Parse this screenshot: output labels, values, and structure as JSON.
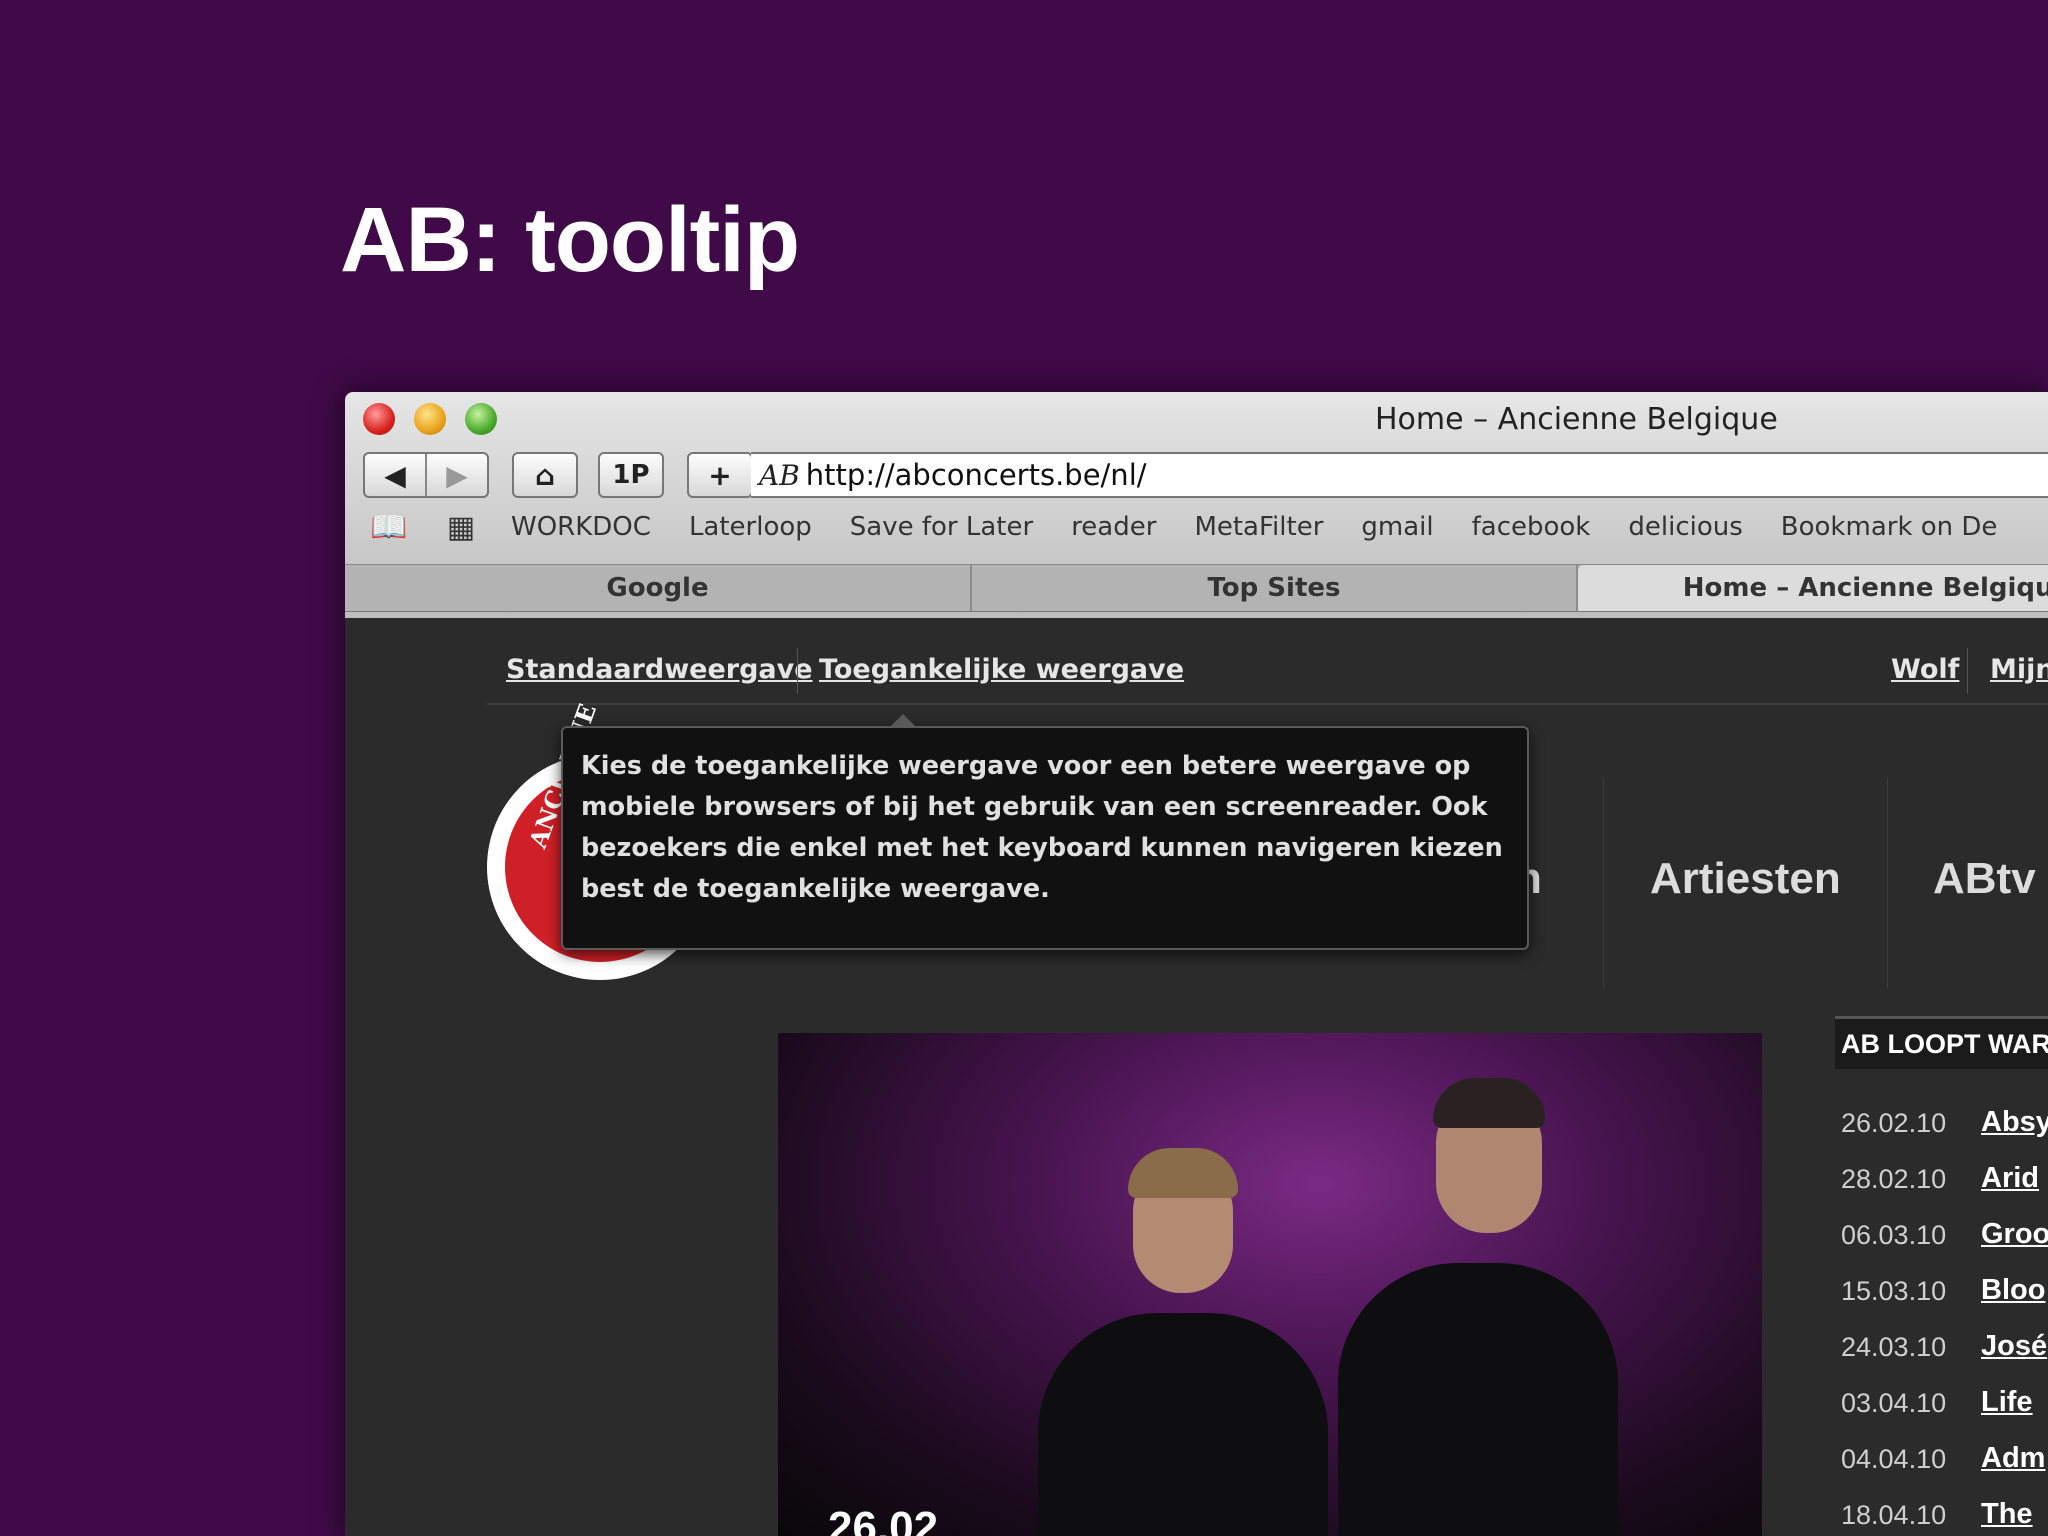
{
  "slide": {
    "title": "AB: tooltip"
  },
  "browser": {
    "window_title": "Home – Ancienne Belgique",
    "toolbar": {
      "back_glyph": "◀",
      "forward_glyph": "▶",
      "home_glyph": "⌂",
      "onepassword_label": "1P",
      "add_bookmark_glyph": "+",
      "url_icon": "AB",
      "url": "http://abconcerts.be/nl/"
    },
    "bookmarks_bar": {
      "items": [
        "WORKDOC",
        "Laterloop",
        "Save for Later",
        "reader",
        "MetaFilter",
        "gmail",
        "facebook",
        "delicious",
        "Bookmark on De"
      ]
    },
    "tabs": [
      {
        "label": "Google",
        "active": false
      },
      {
        "label": "Top Sites",
        "active": false
      },
      {
        "label": "Home – Ancienne Belgique",
        "active": true
      }
    ]
  },
  "page": {
    "view_links": {
      "standard": "Standaardweergave",
      "accessible": "Toegankelijke weergave"
    },
    "user_links": [
      "Wolf",
      "Mijn"
    ],
    "logo_text": "ANCIENNE",
    "nav": [
      "n",
      "Artiesten",
      "ABtv"
    ],
    "tooltip": {
      "lines": [
        "Kies de toegankelijke weergave voor een betere weergave op",
        "mobiele browsers of bij het gebruik van een screenreader. Ook",
        "bezoekers die enkel met het keyboard kunnen navigeren kiezen",
        "best de toegankelijke weergave."
      ]
    },
    "hero": {
      "date_partial": "26.02"
    },
    "sidebar": {
      "header": "AB LOOPT WAR",
      "rows": [
        {
          "date": "26.02.10",
          "title": "Absy"
        },
        {
          "date": "28.02.10",
          "title": "Arid"
        },
        {
          "date": "06.03.10",
          "title": "Groo"
        },
        {
          "date": "15.03.10",
          "title": "Bloo"
        },
        {
          "date": "24.03.10",
          "title": "José"
        },
        {
          "date": "03.04.10",
          "title": "Life"
        },
        {
          "date": "04.04.10",
          "title": "Adm"
        },
        {
          "date": "18.04.10",
          "title": "The"
        }
      ]
    }
  },
  "colors": {
    "slide_bg": "#3f0a47",
    "page_bg": "#2b2b2b",
    "logo_red": "#d02027"
  }
}
